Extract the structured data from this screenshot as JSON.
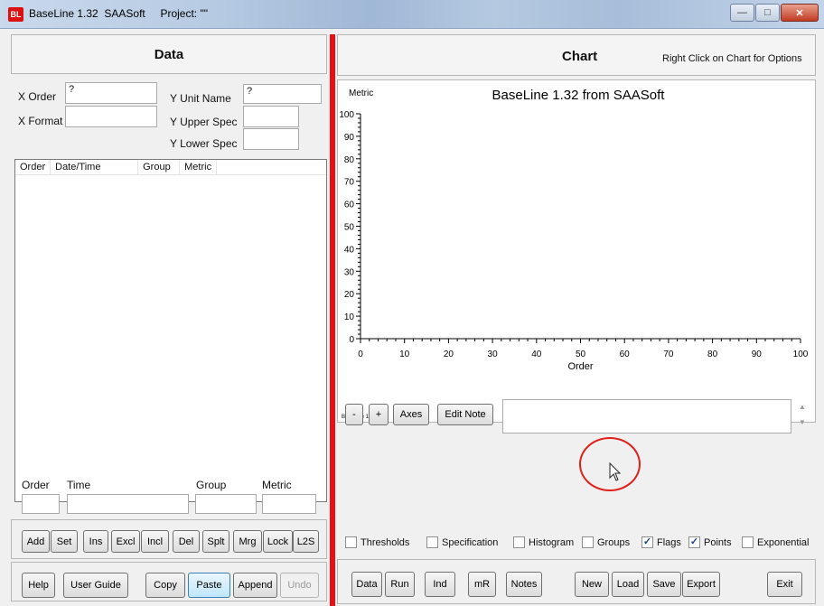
{
  "window": {
    "app_icon": "BL",
    "title": "BaseLine 1.32  SAASoft",
    "project": "Project: \"\"",
    "minimize_icon": "minimize-icon",
    "maximize_icon": "maximize-icon",
    "close_icon": "close-icon"
  },
  "data_panel": {
    "title": "Data",
    "x_order_label": "X Order",
    "x_order_value": "?",
    "x_format_label": "X Format",
    "x_format_value": "",
    "y_unit_label": "Y Unit Name",
    "y_unit_value": "?",
    "y_upper_label": "Y Upper Spec",
    "y_upper_value": "",
    "y_lower_label": "Y Lower Spec",
    "y_lower_value": "",
    "columns": [
      "Order",
      "Date/Time",
      "Group",
      "Metric"
    ],
    "entry_labels": [
      "Order",
      "Time",
      "Group",
      "Metric"
    ],
    "edit_buttons": [
      "Add",
      "Set",
      "Ins",
      "Excl",
      "Incl",
      "Del",
      "Splt",
      "Mrg",
      "Lock",
      "L2S"
    ],
    "help_label": "Help",
    "user_guide_label": "User Guide",
    "copy_label": "Copy",
    "paste_label": "Paste",
    "append_label": "Append",
    "undo_label": "Undo"
  },
  "chart_panel": {
    "title": "Chart",
    "hint": "Right Click on Chart for Options",
    "minus_label": "-",
    "plus_label": "+",
    "axes_label": "Axes",
    "edit_note_label": "Edit Note",
    "note_text": "",
    "scroll_up_icon": "scroll-up-icon",
    "scroll_down_icon": "scroll-down-icon",
    "checkboxes": [
      {
        "label": "Thresholds",
        "checked": false
      },
      {
        "label": "Specification",
        "checked": false
      },
      {
        "label": "Histogram",
        "checked": false
      },
      {
        "label": "Groups",
        "checked": false
      },
      {
        "label": "Flags",
        "checked": true
      },
      {
        "label": "Points",
        "checked": true
      },
      {
        "label": "Exponential",
        "checked": false
      }
    ],
    "bottom_buttons": [
      "Data",
      "Run",
      "Ind",
      "mR",
      "Notes"
    ],
    "new_label": "New",
    "load_label": "Load",
    "save_label": "Save",
    "export_label": "Export",
    "exit_label": "Exit"
  },
  "chart_data": {
    "type": "scatter",
    "title": "BaseLine 1.32 from SAASoft",
    "xlabel": "Order",
    "ylabel": "Metric",
    "xlim": [
      0,
      100
    ],
    "ylim": [
      0,
      100
    ],
    "x_ticks": [
      0,
      10,
      20,
      30,
      40,
      50,
      60,
      70,
      80,
      90,
      100
    ],
    "y_ticks": [
      0,
      10,
      20,
      30,
      40,
      50,
      60,
      70,
      80,
      90,
      100
    ],
    "x": [],
    "y": [],
    "grid": false,
    "footer": "BaseLine 1.32.020"
  },
  "cursor": {
    "icon": "mouse-pointer-icon",
    "highlight_color": "#e0201a"
  }
}
